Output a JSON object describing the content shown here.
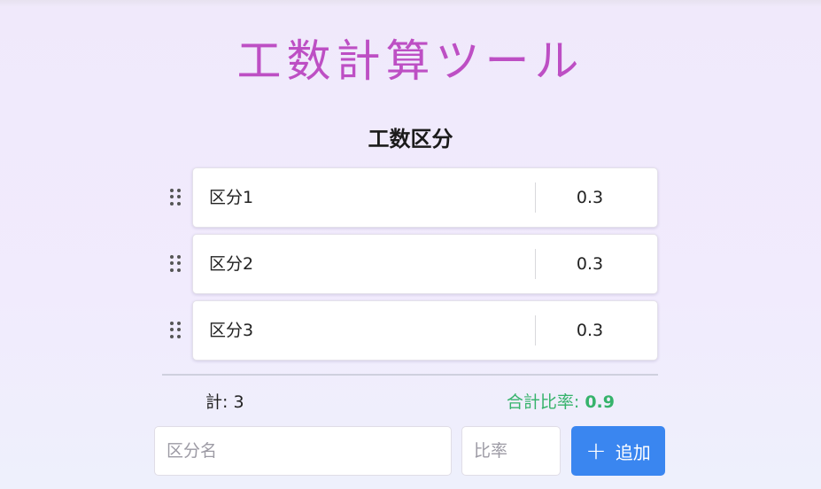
{
  "app": {
    "title": "工数計算ツール"
  },
  "section": {
    "title": "工数区分"
  },
  "rows": [
    {
      "name": "区分1",
      "value": "0.3"
    },
    {
      "name": "区分2",
      "value": "0.3"
    },
    {
      "name": "区分3",
      "value": "0.3"
    }
  ],
  "summary": {
    "count_label": "計: 3",
    "ratio_label": "合計比率:",
    "ratio_value": "0.9"
  },
  "form": {
    "name_placeholder": "区分名",
    "ratio_placeholder": "比率",
    "add_label": "追加",
    "add_icon": "plus-icon"
  },
  "colors": {
    "title": "#bd4fc4",
    "accent": "#3a86f0",
    "ratio": "#36b36b"
  }
}
